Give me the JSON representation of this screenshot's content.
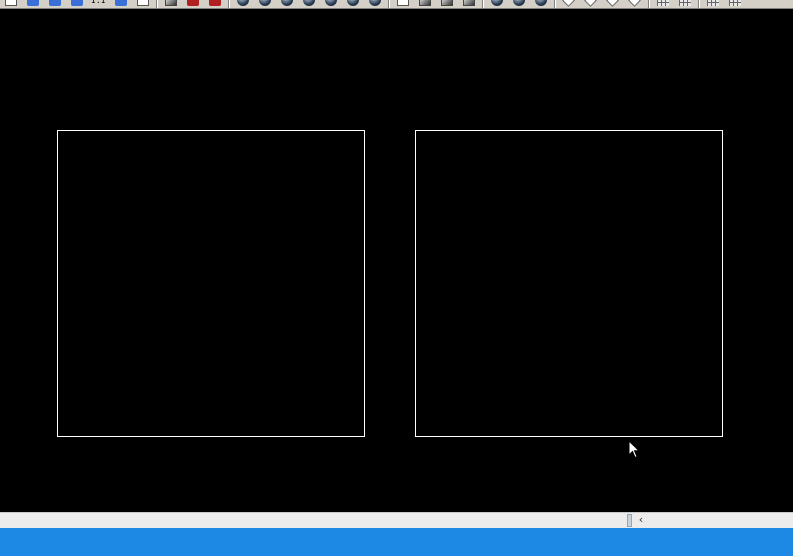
{
  "window": {
    "background": "#000000",
    "accent": "#1e88e5",
    "viewport_border_color": "#ffffff"
  },
  "toolbar": {
    "groups": [
      {
        "buttons": [
          {
            "icon": "layer-list-icon"
          },
          {
            "icon": "blue-panel-icon"
          },
          {
            "icon": "blue-panel-icon"
          },
          {
            "icon": "blue-panel-icon"
          },
          {
            "icon": "text-style-icon",
            "label": "I:1"
          },
          {
            "icon": "swap-icon"
          },
          {
            "icon": "document-icon"
          }
        ]
      },
      {
        "buttons": [
          {
            "icon": "image-icon"
          },
          {
            "icon": "add-red-icon"
          },
          {
            "icon": "pencil-icon"
          }
        ]
      },
      {
        "buttons": [
          {
            "icon": "shade-sphere-icon"
          },
          {
            "icon": "shade-sphere-icon"
          },
          {
            "icon": "shade-sphere-icon"
          },
          {
            "icon": "shade-sphere-icon"
          },
          {
            "icon": "shade-sphere-icon"
          },
          {
            "icon": "shade-sphere-icon"
          },
          {
            "icon": "orbit-icon"
          }
        ]
      },
      {
        "buttons": [
          {
            "icon": "render-icon"
          },
          {
            "icon": "render-icon"
          },
          {
            "icon": "render-icon"
          },
          {
            "icon": "render-icon"
          }
        ]
      },
      {
        "buttons": [
          {
            "icon": "view-icon"
          },
          {
            "icon": "view-icon"
          },
          {
            "icon": "view-icon"
          },
          {
            "icon": "diamond-icon"
          },
          {
            "icon": "diamond-icon"
          },
          {
            "icon": "diamond-icon"
          },
          {
            "icon": "diamond-icon"
          }
        ]
      },
      {
        "buttons": [
          {
            "icon": "grid-icon"
          },
          {
            "icon": "grid-icon"
          },
          {
            "icon": "grid-icon"
          },
          {
            "icon": "grid-icon"
          }
        ]
      }
    ]
  },
  "viewports": [
    {
      "name": "left-viewport"
    },
    {
      "name": "right-viewport"
    }
  ],
  "scrollbar": {
    "arrow": "‹"
  }
}
